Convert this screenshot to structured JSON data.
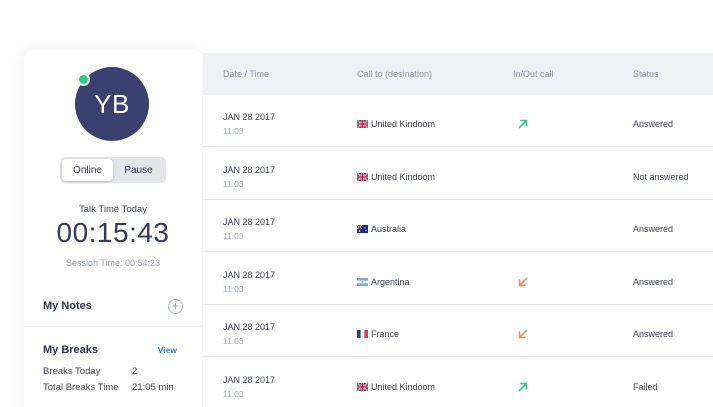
{
  "agent": {
    "initials": "YB",
    "status_options": [
      "Online",
      "Pause"
    ],
    "talk_time_label": "Talk Time Today",
    "talk_time": "00:15:43",
    "session_time": "Session Time: 00:54:23",
    "notes_title": "My Notes",
    "breaks_title": "My Breaks",
    "breaks_view": "View",
    "breaks": [
      {
        "label": "Breaks Today",
        "value": "2"
      },
      {
        "label": "Total Breaks Time",
        "value": "21:05 min"
      }
    ]
  },
  "colors": {
    "avatar_bg": "#3a4170",
    "online_dot": "#2ecc8b",
    "outgoing_arrow": "#2ecc8b",
    "incoming_arrow": "#f08a5d",
    "link": "#2f7fd8"
  },
  "table": {
    "headers": [
      "Date / Time",
      "Call to (desination)",
      "In/Out call",
      "Status"
    ],
    "rows": [
      {
        "date": "JAN 28 2017",
        "time": "11:03",
        "flag": "uk-flag-icon",
        "destination": "United Kindoom",
        "direction": "out",
        "status": "Answered"
      },
      {
        "date": "JAN 28 2017",
        "time": "11:03",
        "flag": "uk-flag-icon",
        "destination": "United Kindoom",
        "direction": "none",
        "status": "Not answered"
      },
      {
        "date": "JAN 28 2017",
        "time": "11:03",
        "flag": "australia-flag-icon",
        "destination": "Australia",
        "direction": "none",
        "status": "Answered"
      },
      {
        "date": "JAN 28 2017",
        "time": "11:03",
        "flag": "argentina-flag-icon",
        "destination": "Argentina",
        "direction": "in",
        "status": "Answered"
      },
      {
        "date": "JAN 28 2017",
        "time": "11:03",
        "flag": "france-flag-icon",
        "destination": "France",
        "direction": "in",
        "status": "Answered"
      },
      {
        "date": "JAN 28 2017",
        "time": "11:03",
        "flag": "uk-flag-icon",
        "destination": "United Kindoom",
        "direction": "out",
        "status": "Failed"
      }
    ]
  }
}
